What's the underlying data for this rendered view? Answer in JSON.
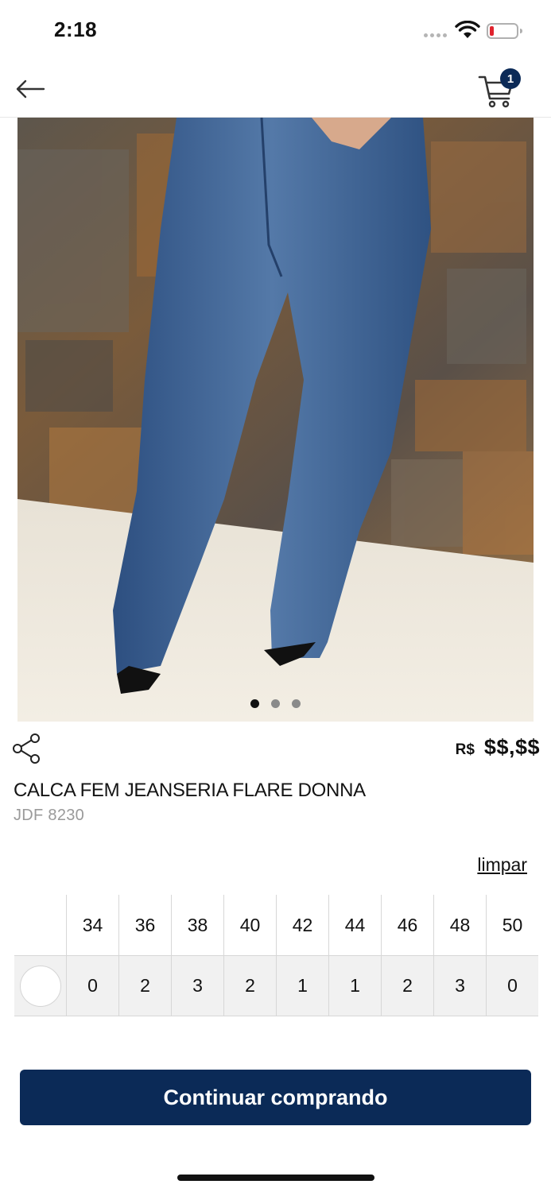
{
  "status_bar": {
    "time": "2:18"
  },
  "header": {
    "cart_count": "1"
  },
  "gallery": {
    "page_count": 3,
    "active_index": 0
  },
  "product": {
    "price_currency": "R$",
    "price_value": "$$,$$",
    "title": "CALCA FEM JEANSERIA FLARE DONNA",
    "code": "JDF 8230"
  },
  "sizes": {
    "clear_label": "limpar",
    "columns": [
      "34",
      "36",
      "38",
      "40",
      "42",
      "44",
      "46",
      "48",
      "50"
    ],
    "quantities": [
      "0",
      "2",
      "3",
      "2",
      "1",
      "1",
      "2",
      "3",
      "0"
    ]
  },
  "actions": {
    "continue_label": "Continuar comprando"
  },
  "colors": {
    "primary": "#0b2a57",
    "badge": "#0b2a57",
    "battery_low": "#e0232e"
  }
}
